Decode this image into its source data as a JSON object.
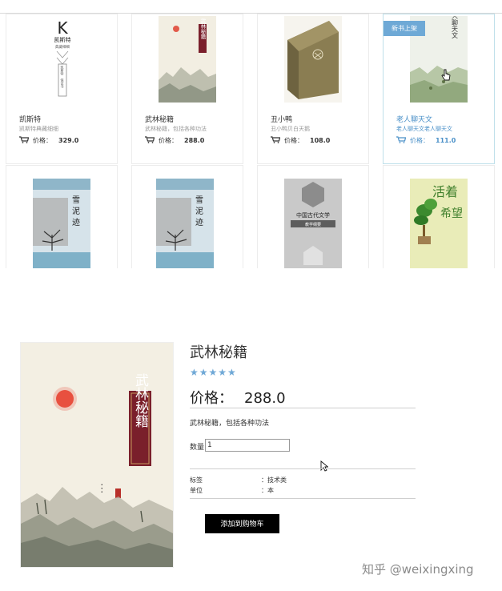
{
  "products": [
    {
      "name": "凯斯特",
      "desc": "凯斯特典藏细细",
      "price_label": "价格：",
      "price": "329.0",
      "cover_text": [
        "K",
        "凯斯特",
        "典藏细细",
        "凯斯特",
        "保证书"
      ]
    },
    {
      "name": "武林秘籍",
      "desc": "武林秘籍，包括各种功法",
      "price_label": "价格：",
      "price": "288.0",
      "cover_text": [
        "武林秘籍"
      ]
    },
    {
      "name": "丑小鸭",
      "desc": "丑小鸭贝白天鹅",
      "price_label": "价格：",
      "price": "108.0",
      "cover_text": []
    },
    {
      "name": "老人聊天文",
      "desc": "老人聊天文老人聊天文",
      "price_label": "价格：",
      "price": "111.0",
      "cover_text": [
        "老人聊天文"
      ],
      "badge": "新书上架"
    },
    {
      "name": "",
      "desc": "",
      "price_label": "",
      "price": "",
      "cover_text": [
        "雪",
        "泥",
        "迹"
      ]
    },
    {
      "name": "",
      "desc": "",
      "price_label": "",
      "price": "",
      "cover_text": [
        "雪",
        "泥",
        "迹"
      ]
    },
    {
      "name": "",
      "desc": "",
      "price_label": "",
      "price": "",
      "cover_text": [
        "中国古代文学",
        "教学纲要"
      ]
    },
    {
      "name": "",
      "desc": "",
      "price_label": "",
      "price": "",
      "cover_text": [
        "活着",
        "希望"
      ]
    }
  ],
  "detail": {
    "title": "武林秘籍",
    "stars": "★★★★★",
    "price_label": "价格：",
    "price": "288.0",
    "description": "武林秘籍，包括各种功法",
    "qty_label": "数量",
    "qty_value": "1",
    "attrs": [
      {
        "key": "标签",
        "value": "：技术类"
      },
      {
        "key": "单位",
        "value": "：本"
      }
    ],
    "add_button": "添加到购物车",
    "cover_title": "武林秘籍"
  },
  "watermark": "知乎 @weixingxing",
  "colors": {
    "accent": "#6ea9d6",
    "button": "#000000",
    "seal": "#7a1f2b"
  }
}
